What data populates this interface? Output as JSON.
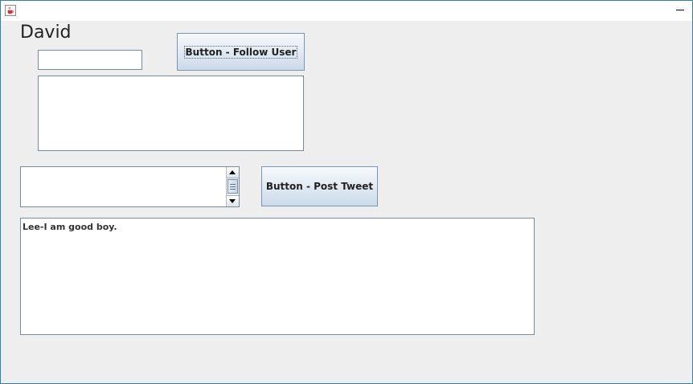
{
  "window": {
    "title": "",
    "app_icon": "java-cup-icon",
    "minimize_icon": "minimize-icon"
  },
  "user": {
    "name": "David"
  },
  "follow": {
    "input_value": "",
    "button_label": "Button - Follow User",
    "following_list": []
  },
  "tweet": {
    "input_value": "",
    "button_label": "Button - Post Tweet"
  },
  "feed": {
    "items": [
      "Lee-I am good boy."
    ]
  }
}
